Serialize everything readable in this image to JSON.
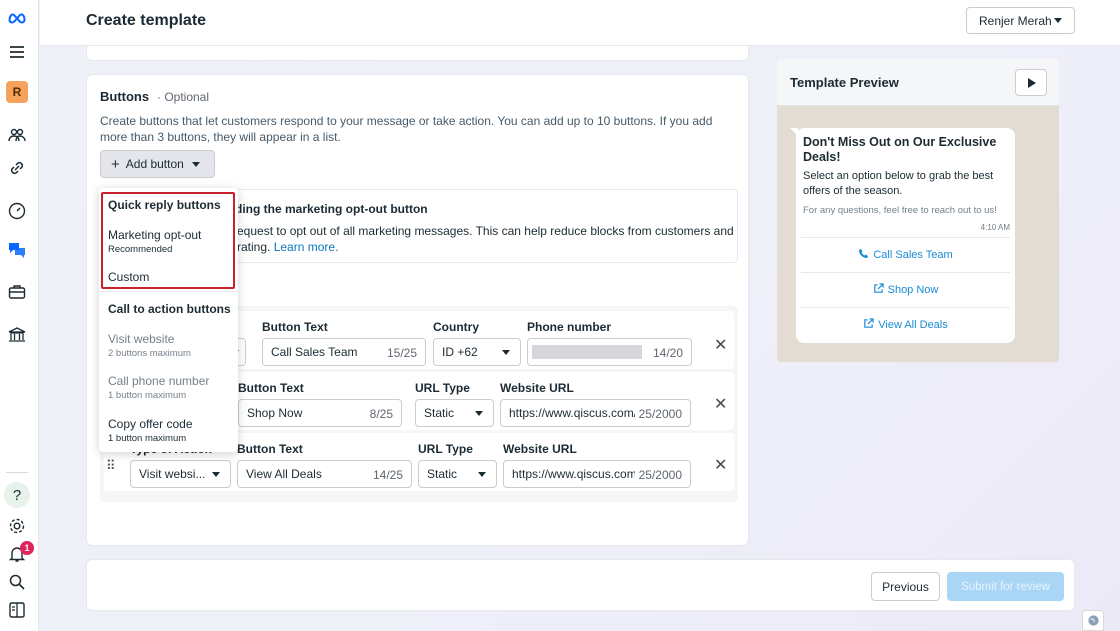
{
  "header": {
    "title": "Create template",
    "account": "Renjer Merah"
  },
  "rail": {
    "workspace_initial": "R",
    "notification_count": "1",
    "help_glyph": "?"
  },
  "buttons_section": {
    "title": "Buttons",
    "optional": "· Optional",
    "description": "Create buttons that let customers respond to your message or take action. You can add up to 10 buttons. If you add more than 3 buttons, they will appear in a list.",
    "add_button_label": "Add button",
    "add_button_plus": "+"
  },
  "info_box": {
    "title": "ding the marketing opt-out button",
    "line1": "equest to opt out of all marketing messages. This can help reduce blocks from customers and",
    "line2": "rating.",
    "link": "Learn more."
  },
  "dropdown": {
    "quick_reply_header": "Quick reply buttons",
    "quick_reply_items": [
      {
        "label": "Marketing opt-out",
        "sub": "Recommended"
      },
      {
        "label": "Custom",
        "sub": ""
      }
    ],
    "cta_header": "Call to action buttons",
    "cta_items": [
      {
        "label": "Visit website",
        "sub": "2 buttons maximum"
      },
      {
        "label": "Call phone number",
        "sub": "1 button maximum"
      },
      {
        "label": "Copy offer code",
        "sub": "1 button maximum"
      }
    ]
  },
  "rows": [
    {
      "button_text_label": "Button Text",
      "button_text_value": "Call Sales Team",
      "button_text_count": "15/25",
      "col3_label": "Country",
      "col3_value": "ID +62",
      "col4_label": "Phone number",
      "col4_count": "14/20"
    },
    {
      "button_text_label": "Button Text",
      "button_text_value": "Shop Now",
      "button_text_count": "8/25",
      "col3_label": "URL Type",
      "col3_value": "Static",
      "col4_label": "Website URL",
      "col4_value": "https://www.qiscus.com/",
      "col4_count": "25/2000"
    },
    {
      "type_label": "Type of Action",
      "type_value": "Visit websi...",
      "button_text_label": "Button Text",
      "button_text_value": "View All Deals",
      "button_text_count": "14/25",
      "col3_label": "URL Type",
      "col3_value": "Static",
      "col4_label": "Website URL",
      "col4_value": "https://www.qiscus.com",
      "col4_count": "25/2000"
    }
  ],
  "preview": {
    "title": "Template Preview",
    "message_title": "Don't Miss Out on Our Exclusive Deals!",
    "message_body": "Select an option below to grab the best offers of the season.",
    "message_footer": "For any questions, feel free to reach out to us!",
    "time": "4:10 AM",
    "buttons": [
      {
        "icon": "phone-icon",
        "label": "Call Sales Team"
      },
      {
        "icon": "external-link-icon",
        "label": "Shop Now"
      },
      {
        "icon": "external-link-icon",
        "label": "View All Deals"
      }
    ]
  },
  "footer": {
    "previous": "Previous",
    "submit": "Submit for review"
  },
  "colors": {
    "accent_link": "#0a78be",
    "highlight_border": "#c8232c",
    "submit_disabled": "#a9d6f5",
    "badge": "#e0245e"
  }
}
